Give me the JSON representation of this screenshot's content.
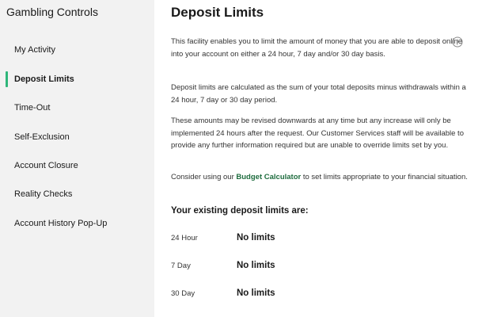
{
  "sidebar": {
    "title": "Gambling Controls",
    "items": [
      {
        "label": "My Activity"
      },
      {
        "label": "Deposit Limits",
        "active": true
      },
      {
        "label": "Time-Out"
      },
      {
        "label": "Self-Exclusion"
      },
      {
        "label": "Account Closure"
      },
      {
        "label": "Reality Checks"
      },
      {
        "label": "Account History Pop-Up"
      }
    ]
  },
  "main": {
    "title": "Deposit Limits",
    "info_icon": "info-icon",
    "paragraphs": [
      "This facility enables you to limit the amount of money that you are able to deposit online into your account on either a 24 hour, 7 day and/or 30 day basis.",
      "Deposit limits are calculated as the sum of your total deposits minus withdrawals within a 24 hour, 7 day or 30 day period.",
      "These amounts may be revised downwards at any time but any increase will only be implemented 24 hours after the request. Our Customer Services staff will be available to provide any further information required but are unable to override limits set by you."
    ],
    "consider": {
      "before": "Consider using our ",
      "link": "Budget Calculator",
      "after": " to set limits appropriate to your financial situation."
    },
    "existing_heading": "Your existing deposit limits are:",
    "limits": [
      {
        "period": "24 Hour",
        "value": "No limits"
      },
      {
        "period": "7 Day",
        "value": "No limits"
      },
      {
        "period": "30 Day",
        "value": "No limits"
      }
    ]
  },
  "colors": {
    "sidebar_bg": "#f2f2f2",
    "active_indicator": "#2fb67a",
    "link": "#1f6d3f"
  }
}
